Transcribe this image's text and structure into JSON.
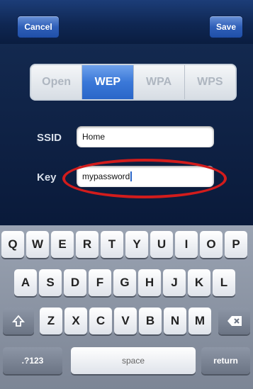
{
  "nav": {
    "cancel_label": "Cancel",
    "save_label": "Save"
  },
  "security_tabs": [
    "Open",
    "WEP",
    "WPA",
    "WPS"
  ],
  "selected_tab": "WEP",
  "form": {
    "ssid_label": "SSID",
    "ssid_value": "Home",
    "key_label": "Key",
    "key_value": "mypassword"
  },
  "keyboard": {
    "row1": [
      "Q",
      "W",
      "E",
      "R",
      "T",
      "Y",
      "U",
      "I",
      "O",
      "P"
    ],
    "row2": [
      "A",
      "S",
      "D",
      "F",
      "G",
      "H",
      "J",
      "K",
      "L"
    ],
    "row3": [
      "Z",
      "X",
      "C",
      "V",
      "B",
      "N",
      "M"
    ],
    "numbers_label": ".?123",
    "space_label": "space",
    "return_label": "return",
    "shift_icon": "shift-icon",
    "delete_icon": "delete-icon"
  },
  "colors": {
    "highlight": "#d21c1c",
    "accent": "#2a66c8"
  }
}
